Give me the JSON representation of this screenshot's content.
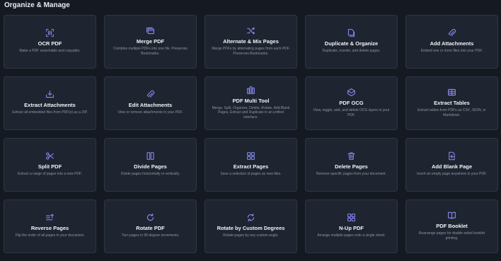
{
  "section": {
    "title": "Organize & Manage"
  },
  "colors": {
    "background": "#151a22",
    "card": "#1f2530",
    "card_border": "#2e3644",
    "accent_icon": "#8b8cf6",
    "title_text": "#f1f3f7",
    "desc_text": "#8d95a3"
  },
  "tools": [
    {
      "icon": "ocr-scan-icon",
      "title": "OCR PDF",
      "desc": "Make a PDF searchable and copyable."
    },
    {
      "icon": "merge-pages-icon",
      "title": "Merge PDF",
      "desc": "Combine multiple PDFs into one file. Preserves Bookmarks."
    },
    {
      "icon": "shuffle-icon",
      "title": "Alternate & Mix Pages",
      "desc": "Merge PDFs by alternating pages from each PDF. Preserves Bookmarks."
    },
    {
      "icon": "duplicate-icon",
      "title": "Duplicate & Organize",
      "desc": "Duplicate, reorder, and delete pages."
    },
    {
      "icon": "paperclip-icon",
      "title": "Add Attachments",
      "desc": "Embed one or more files into your PDF."
    },
    {
      "icon": "tray-download-icon",
      "title": "Extract Attachments",
      "desc": "Extract all embedded files from PDF(s) as a ZIP."
    },
    {
      "icon": "paperclip-icon",
      "title": "Edit Attachments",
      "desc": "View or remove attachments in your PDF."
    },
    {
      "icon": "multi-tool-icon",
      "title": "PDF Multi Tool",
      "desc": "Merge, Split, Organize, Delete, Rotate, Add Blank Pages, Extract and Duplicate in an unified interface."
    },
    {
      "icon": "layers-icon",
      "title": "PDF OCG",
      "desc": "View, toggle, add, and delete OCG layers in your PDF."
    },
    {
      "icon": "table-icon",
      "title": "Extract Tables",
      "desc": "Extract tables from PDFs as CSV, JSON, or Markdown."
    },
    {
      "icon": "scissors-icon",
      "title": "Split PDF",
      "desc": "Extract a range of pages into a new PDF."
    },
    {
      "icon": "columns-icon",
      "title": "Divide Pages",
      "desc": "Divide pages horizontally or vertically."
    },
    {
      "icon": "grid-icon",
      "title": "Extract Pages",
      "desc": "Save a selection of pages as new files."
    },
    {
      "icon": "trash-icon",
      "title": "Delete Pages",
      "desc": "Remove specific pages from your document."
    },
    {
      "icon": "file-plus-icon",
      "title": "Add Blank Page",
      "desc": "Insert an empty page anywhere in your PDF."
    },
    {
      "icon": "reverse-order-icon",
      "title": "Reverse Pages",
      "desc": "Flip the order of all pages in your document."
    },
    {
      "icon": "rotate-icon",
      "title": "Rotate PDF",
      "desc": "Turn pages in 90-degree increments."
    },
    {
      "icon": "rotate-custom-icon",
      "title": "Rotate by Custom Degrees",
      "desc": "Rotate pages by any custom angle."
    },
    {
      "icon": "grid-icon",
      "title": "N-Up PDF",
      "desc": "Arrange multiple pages onto a single sheet."
    },
    {
      "icon": "book-open-icon",
      "title": "PDF Booklet",
      "desc": "Rearrange pages for double-sided booklet printing."
    }
  ]
}
